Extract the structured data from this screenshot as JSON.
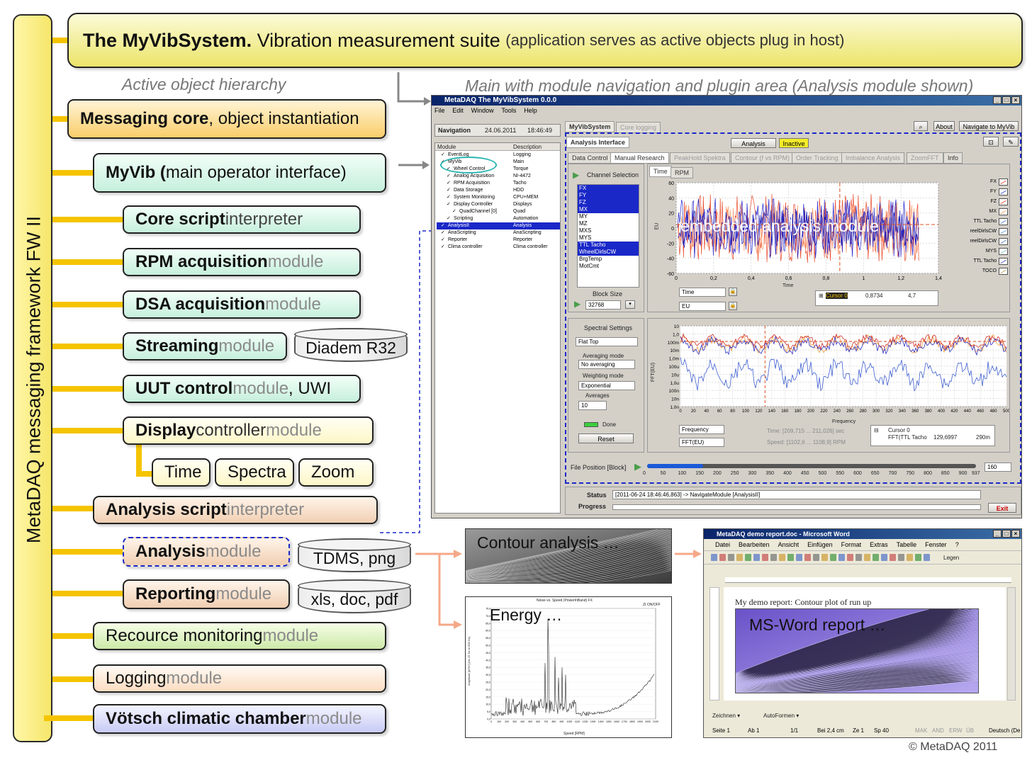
{
  "title": {
    "bold": "The MyVibSystem.",
    "main": " Vibration measurement suite ",
    "paren": "(application serves as active objects plug in host)"
  },
  "framework_label": "MetaDAQ messaging framework FW II",
  "captions": {
    "hierarchy": "Active object hierarchy",
    "main": "Main with module navigation and plugin area (Analysis module shown)"
  },
  "modules": {
    "messaging": {
      "bold": "Messaging core",
      "rest": ", object instantiation"
    },
    "myvib": {
      "bold": "MyVib (",
      "rest": "main operator interface)"
    },
    "core_script": {
      "bold": "Core script",
      "rest": " interpreter"
    },
    "rpm": {
      "bold": "RPM acquisition",
      "rest": " module"
    },
    "dsa": {
      "bold": "DSA acquisition",
      "rest": " module"
    },
    "streaming": {
      "bold": "Streaming",
      "rest": " module"
    },
    "uut": {
      "bold": "UUT control",
      "rest": " module",
      "extra": ", UWI"
    },
    "display": {
      "bold": "Display",
      "rest1": " controller",
      "rest2": " module"
    },
    "analysis_script": {
      "bold": "Analysis script",
      "rest": " interpreter"
    },
    "analysis": {
      "bold": "Analysis",
      "rest": " module"
    },
    "reporting": {
      "bold": "Reporting",
      "rest": " module"
    },
    "resource": {
      "main": "Recource monitoring",
      "rest": " module"
    },
    "logging": {
      "main": "Logging",
      "rest": " module"
    },
    "voetsch": {
      "bold": "Vötsch climatic chamber",
      "rest": " module"
    }
  },
  "sub_boxes": [
    "Time",
    "Spectra",
    "Zoom"
  ],
  "storage": {
    "diadem": "Diadem R32",
    "tdms": "TDMS, png",
    "office": "xls, doc, pdf"
  },
  "thumbs": {
    "contour": "Contour analysis …",
    "energy": "Energy …",
    "word_report": "MS-Word report …"
  },
  "copyright": "© MetaDAQ 2011",
  "app_window": {
    "title": "MetaDAQ The MyVibSystem  0.0.0",
    "menu": [
      "File",
      "Edit",
      "Window",
      "Tools",
      "Help"
    ],
    "nav_label": "Navigation",
    "nav_date": "24.06.2011",
    "nav_time": "18:46:49",
    "tree_headers": [
      "Module",
      "Description"
    ],
    "tree": [
      [
        "EventLog",
        "Logging"
      ],
      [
        "MyVib",
        "Main"
      ],
      [
        "Wheel Control",
        "Torque"
      ],
      [
        "Analog Acquisition",
        "NI-4472"
      ],
      [
        "RPM Acquisition",
        "Tacho"
      ],
      [
        "Data Storage",
        "HDD"
      ],
      [
        "System Monitoring",
        "CPU+MEM"
      ],
      [
        "Display Controller",
        "Displays"
      ],
      [
        "QuadChannel [0]",
        "Quad"
      ],
      [
        "Scripting",
        "Automation"
      ],
      [
        "AnalysisII",
        "Analysis"
      ],
      [
        "AnaScripting",
        "AnaScripting"
      ],
      [
        "Reporter",
        "Reporter"
      ],
      [
        "Clima controller",
        "Clima controller"
      ]
    ],
    "top_tabs": [
      "MyVibSystem",
      "Core logging"
    ],
    "top_buttons": [
      "About",
      "Navigate to MyVib"
    ],
    "analysis_interface": "Analysis Interface",
    "analysis_btn": "Analysis",
    "inactive_btn": "Inactive",
    "sub_tabs": [
      "Data Control",
      "Manual Research",
      "PeakHold Spektra",
      "Contour (f vs RPM)",
      "Order Tracking",
      "Imbalance Analysis",
      "ZoomFFT",
      "Info"
    ],
    "channel_selection": "Channel Selection",
    "channels": [
      "FX",
      "FY",
      "FZ",
      "MX",
      "MY",
      "MZ",
      "MXS",
      "MYS",
      "TTL Tacho",
      "WheelDirlsCW",
      "BrgTemp",
      "MotCmt"
    ],
    "block_size_label": "Block Size",
    "block_size": "32768",
    "time_tabs": [
      "Time",
      "RPM"
    ],
    "time_y_ticks": [
      "60",
      "40",
      "20",
      "0",
      "-20",
      "-40",
      "-60"
    ],
    "time_x_ticks": [
      "0",
      "0,2",
      "0,4",
      "0,6",
      "0,8",
      "1",
      "1,2",
      "1,4"
    ],
    "time_xlabel": "Time",
    "time_ylabel": "EU",
    "embedded": "embedded analysis module",
    "legend": [
      "FX",
      "FY",
      "FZ",
      "MX",
      "TTL Tacho",
      "reelDirlsCW",
      "reelDirlsCW",
      "MYS",
      "TTL Tacho",
      "TOCO"
    ],
    "time_field": "Time",
    "eu_field": "EU",
    "cursor": {
      "name": "Cursor 0",
      "x": "0,8734",
      "y": "4,7"
    },
    "spectral_settings": "Spectral Settings",
    "window_type": "Flat Top",
    "averaging_mode_label": "Averaging mode",
    "averaging_mode": "No averaging",
    "weighting_mode_label": "Weighting mode",
    "weighting_mode": "Exponential",
    "averages_label": "Averages",
    "averages": "10",
    "done": "Done",
    "reset": "Reset",
    "spec_y_ticks": [
      "10",
      "1,0",
      "100m",
      "10m",
      "1,0m",
      "100u",
      "10u",
      "1,0u",
      "100n",
      "10n",
      "1,0n"
    ],
    "spec_x_ticks": [
      "0",
      "20",
      "40",
      "60",
      "80",
      "100",
      "120",
      "140",
      "160",
      "180",
      "200",
      "220",
      "240",
      "260",
      "280",
      "300",
      "320",
      "340",
      "360",
      "380",
      "400",
      "420",
      "440",
      "460",
      "480",
      "500"
    ],
    "spec_xlabel": "Frequency",
    "spec_ylabel": "FFT(EU)",
    "freq_field": "Frequency",
    "fft_field": "FFT(EU)",
    "time_range": "Time: [209,715 ... 211,026] sec",
    "speed_range": "Speed: [1102,6 ... 1108,9] RPM",
    "cursor2": {
      "name": "Cursor 0",
      "label": "FFT(TTL Tacho",
      "x": "129,6997",
      "y": "290m"
    },
    "file_position_label": "File Position [Block]",
    "file_x_ticks": [
      "0",
      "50",
      "100",
      "150",
      "200",
      "250",
      "300",
      "350",
      "400",
      "450",
      "500",
      "550",
      "600",
      "650",
      "700",
      "750",
      "800",
      "850",
      "900",
      "937"
    ],
    "file_position": "160",
    "status_label": "Status",
    "status_text": "[2011-06-24  18:46:46,863] -> NavigateModule [AnalysisII]",
    "progress_label": "Progress",
    "exit": "Exit"
  },
  "word_window": {
    "title": "MetaDAQ demo report.doc - Microsoft Word",
    "menu": [
      "Datei",
      "Bearbeiten",
      "Ansicht",
      "Einfügen",
      "Format",
      "Extras",
      "Tabelle",
      "Fenster",
      "?"
    ],
    "legen": "Legen",
    "doc_text": "My  demo report: Contour plot of run up",
    "drawbar": [
      "Zeichnen ▾",
      "AutoFormen ▾"
    ],
    "statusbar": [
      "Seite  1",
      "Ab  1",
      "1/1",
      "Bei 2,4 cm",
      "Ze  1",
      "Sp  40",
      "MAK",
      "AND",
      "ERW",
      "ÜB",
      "Deutsch (De"
    ]
  },
  "energy_plot": {
    "title": "Noise vs. Speed (PowerInBand) FX",
    "xlabel": "Speed [RPM]",
    "ylabel": "Amplitude [m²/s⁴] (Hz 25 Hz to 500 Hz)",
    "legend": "Zt ON/OFF",
    "y_ticks": [
      "75,0",
      "70,0",
      "65,0",
      "60,0",
      "55,0",
      "50,0",
      "45,0",
      "40,0",
      "35,0",
      "30,0",
      "25,0",
      "20,0",
      "15,0",
      "10,0",
      "5,0",
      "0,0"
    ],
    "x_ticks": [
      "0",
      "100",
      "200",
      "300",
      "400",
      "500",
      "600",
      "700",
      "800",
      "900",
      "1000",
      "1100",
      "1200",
      "1300",
      "1400",
      "1500",
      "1600",
      "1700",
      "1800",
      "1900",
      "2000",
      "2100"
    ]
  },
  "colors": {
    "stem": "#f5c400",
    "dash_blue": "#1a28c8",
    "accent_red": "#e05020",
    "arrow_salmon": "#f4a888"
  }
}
